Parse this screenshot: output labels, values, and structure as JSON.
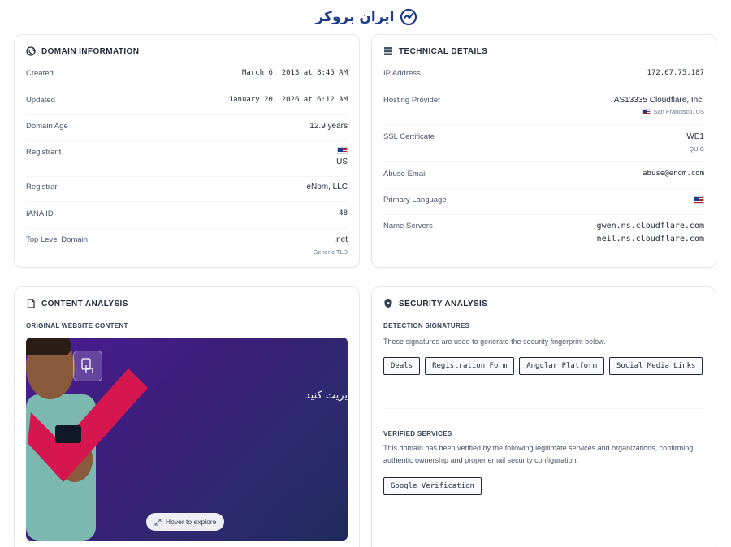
{
  "brand": {
    "logo_text": "ایران بروکر"
  },
  "domain_info": {
    "title": "DOMAIN INFORMATION",
    "created_label": "Created",
    "created_value": "March 6, 2013 at 8:45 AM",
    "updated_label": "Updated",
    "updated_value": "January 20, 2026 at 6:12 AM",
    "age_label": "Domain Age",
    "age_value": "12.9 years",
    "registrant_label": "Registrant",
    "registrant_value": "US",
    "registrar_label": "Registrar",
    "registrar_value": "eNom, LLC",
    "iana_label": "IANA ID",
    "iana_value": "48",
    "tld_label": "Top Level Domain",
    "tld_value": ".net",
    "tld_sub": "Generic TLD"
  },
  "technical": {
    "title": "TECHNICAL DETAILS",
    "ip_label": "IP Address",
    "ip_value": "172.67.75.187",
    "hosting_label": "Hosting Provider",
    "hosting_value": "AS13335 Cloudflare, Inc.",
    "hosting_sub": "San Francisco, US",
    "ssl_label": "SSL Certificate",
    "ssl_value": "WE1",
    "ssl_sub": "QUIC",
    "abuse_label": "Abuse Email",
    "abuse_value": "abuse@enom.com",
    "lang_label": "Primary Language",
    "ns_label": "Name Servers",
    "ns_values": [
      "gwen.ns.cloudflare.com",
      "neil.ns.cloudflare.com"
    ]
  },
  "content": {
    "title": "CONTENT ANALYSIS",
    "section_label": "ORIGINAL WEBSITE CONTENT",
    "preview_text": "یریت کنید",
    "hover_label": "Hover to explore"
  },
  "security": {
    "title": "SECURITY ANALYSIS",
    "detection_label": "DETECTION SIGNATURES",
    "detection_desc": "These signatures are used to generate the security fingerprint below.",
    "signatures": [
      "Deals",
      "Registration Form",
      "Angular Platform",
      "Social Media Links"
    ],
    "verified_label": "VERIFIED SERVICES",
    "verified_desc": "This domain has been verified by the following legitimate services and organizations, confirming authentic ownership and proper email security configuration.",
    "verified_services": [
      "Google Verification"
    ]
  },
  "colors": {
    "accent": "#1e3a8a",
    "chip_border": "#1e293b",
    "preview_bg": "#3b1e7a",
    "banner_red": "#d6164f"
  }
}
